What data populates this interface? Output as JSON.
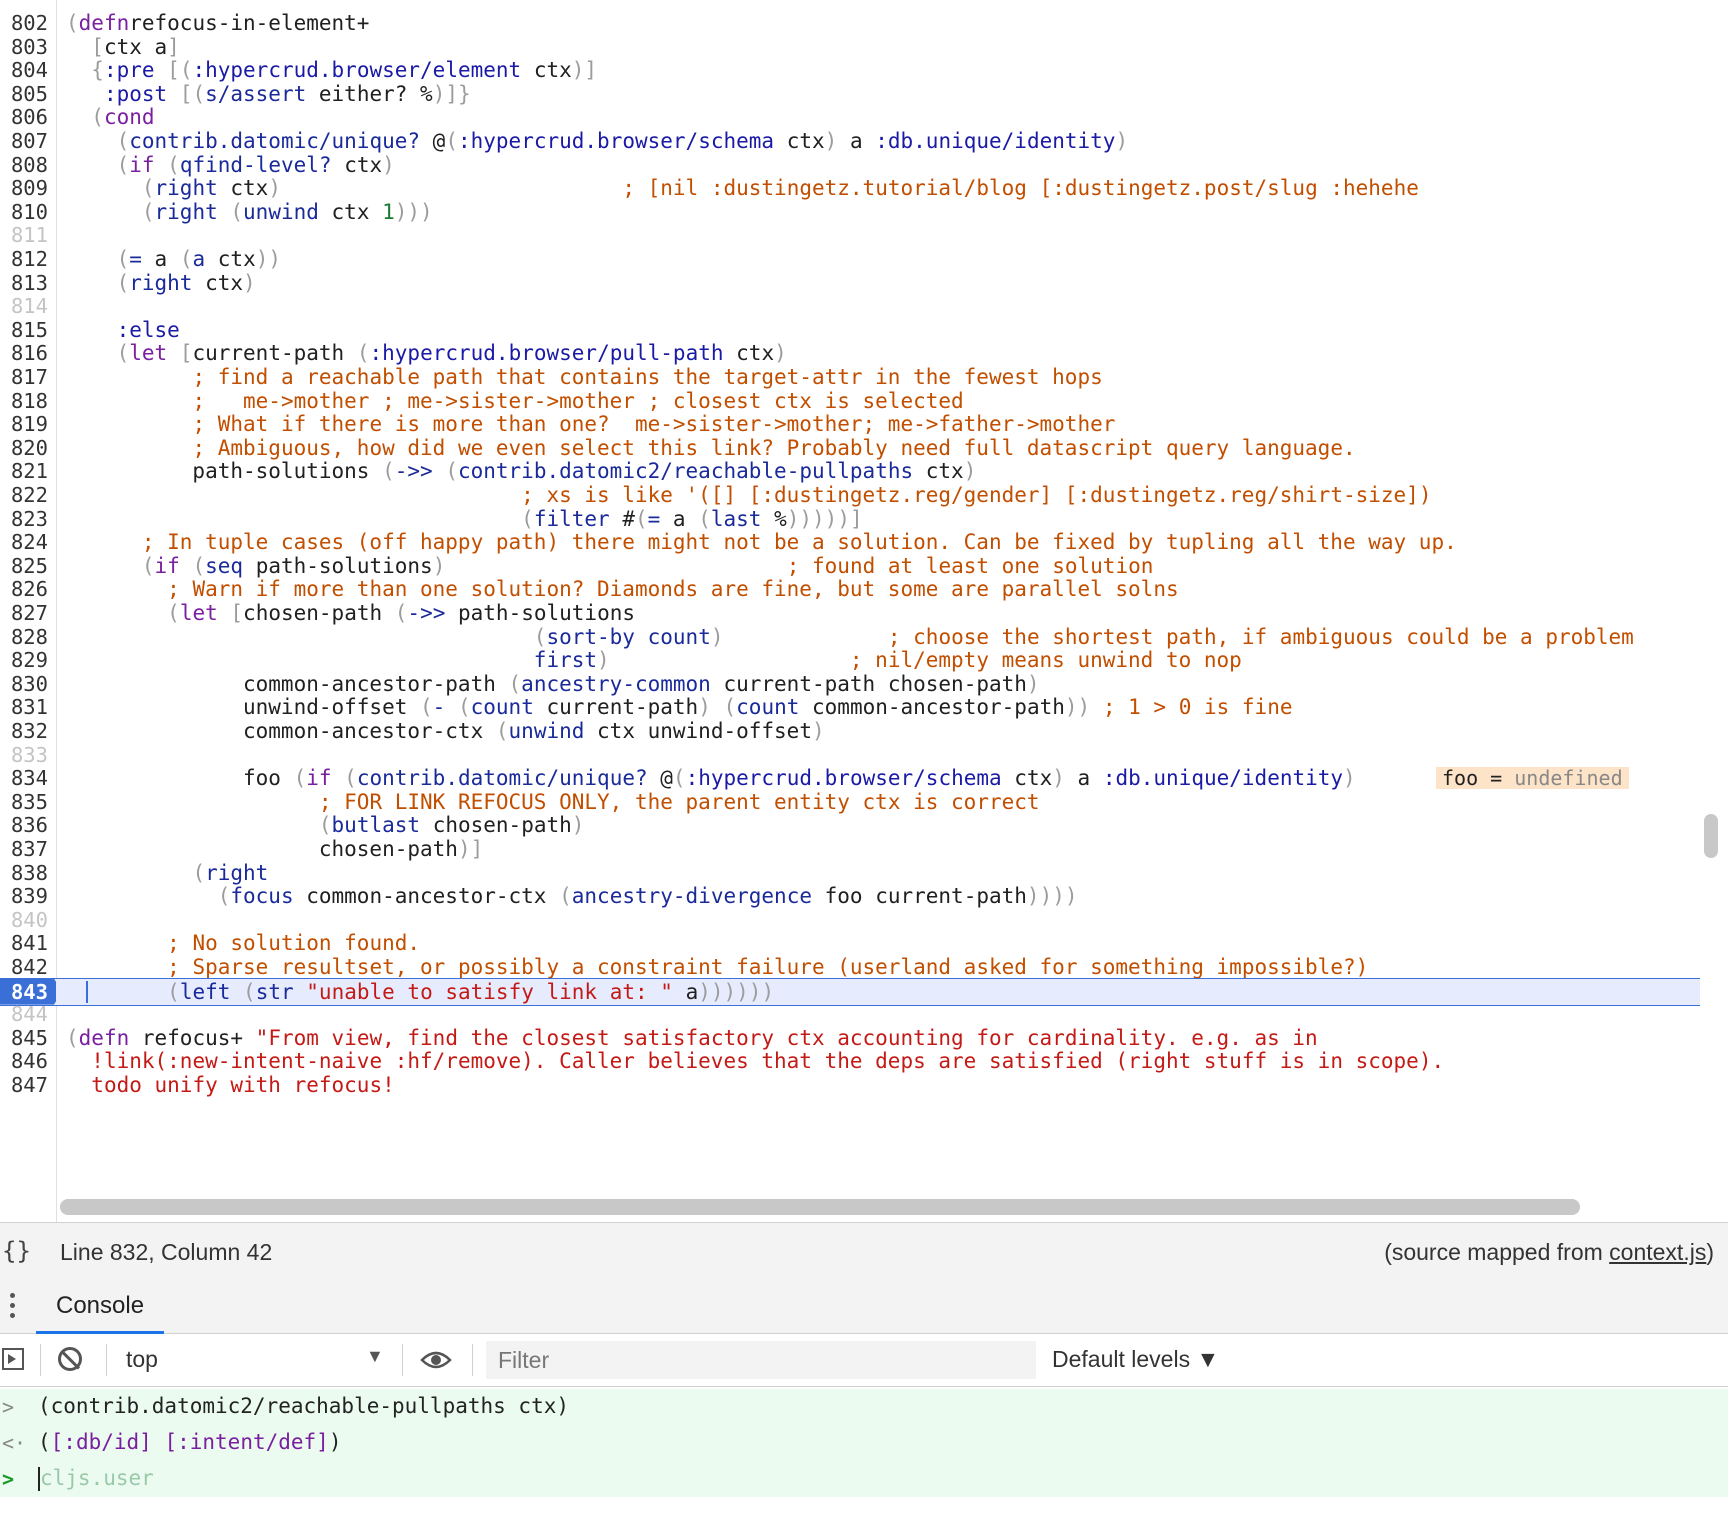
{
  "editor": {
    "lines": [
      {
        "n": "802",
        "segs": [
          [
            "p",
            "("
          ],
          [
            "kw",
            "defn"
          ],
          [
            "",
            "refocus-in-element+"
          ]
        ]
      },
      {
        "n": "803",
        "segs": [
          [
            "",
            "  "
          ],
          [
            "p",
            "["
          ],
          [
            "",
            "ctx a"
          ],
          [
            "p",
            "]"
          ]
        ]
      },
      {
        "n": "804",
        "segs": [
          [
            "",
            "  "
          ],
          [
            "p",
            "{"
          ],
          [
            "kwd",
            ":pre"
          ],
          [
            "p",
            " [("
          ],
          [
            "kwd",
            ":hypercrud.browser/element"
          ],
          [
            "",
            " ctx"
          ],
          [
            "p",
            ")]"
          ]
        ]
      },
      {
        "n": "805",
        "segs": [
          [
            "",
            "   "
          ],
          [
            "kwd",
            ":post"
          ],
          [
            "p",
            " [("
          ],
          [
            "sym",
            "s/assert"
          ],
          [
            "",
            " either? %"
          ],
          [
            "p",
            ")]}"
          ]
        ]
      },
      {
        "n": "806",
        "segs": [
          [
            "",
            "  "
          ],
          [
            "p",
            "("
          ],
          [
            "kw",
            "cond"
          ]
        ]
      },
      {
        "n": "807",
        "segs": [
          [
            "",
            "    "
          ],
          [
            "p",
            "("
          ],
          [
            "sym",
            "contrib.datomic/unique?"
          ],
          [
            "",
            " @"
          ],
          [
            "p",
            "("
          ],
          [
            "kwd",
            ":hypercrud.browser/schema"
          ],
          [
            "",
            " ctx"
          ],
          [
            "p",
            ")"
          ],
          [
            "",
            " a "
          ],
          [
            "kwd",
            ":db.unique/identity"
          ],
          [
            "p",
            ")"
          ]
        ]
      },
      {
        "n": "808",
        "segs": [
          [
            "",
            "    "
          ],
          [
            "p",
            "("
          ],
          [
            "kw",
            "if"
          ],
          [
            "p",
            " ("
          ],
          [
            "sym",
            "qfind-level?"
          ],
          [
            "",
            " ctx"
          ],
          [
            "p",
            ")"
          ]
        ]
      },
      {
        "n": "809",
        "segs": [
          [
            "",
            "      "
          ],
          [
            "p",
            "("
          ],
          [
            "sym",
            "right"
          ],
          [
            "",
            " ctx"
          ],
          [
            "p",
            ")"
          ],
          [
            "",
            "                           "
          ],
          [
            "cm",
            "; [nil :dustingetz.tutorial/blog [:dustingetz.post/slug :hehehe"
          ]
        ]
      },
      {
        "n": "810",
        "segs": [
          [
            "",
            "      "
          ],
          [
            "p",
            "("
          ],
          [
            "sym",
            "right"
          ],
          [
            "p",
            " ("
          ],
          [
            "sym",
            "unwind"
          ],
          [
            "",
            " ctx "
          ],
          [
            "num",
            "1"
          ],
          [
            "p",
            ")))"
          ]
        ]
      },
      {
        "n": "811",
        "segs": []
      },
      {
        "n": "812",
        "segs": [
          [
            "",
            "    "
          ],
          [
            "p",
            "("
          ],
          [
            "sym",
            "="
          ],
          [
            "",
            " a "
          ],
          [
            "p",
            "("
          ],
          [
            "sym",
            "a"
          ],
          [
            "",
            " ctx"
          ],
          [
            "p",
            "))"
          ]
        ]
      },
      {
        "n": "813",
        "segs": [
          [
            "",
            "    "
          ],
          [
            "p",
            "("
          ],
          [
            "sym",
            "right"
          ],
          [
            "",
            " ctx"
          ],
          [
            "p",
            ")"
          ]
        ]
      },
      {
        "n": "814",
        "segs": []
      },
      {
        "n": "815",
        "segs": [
          [
            "",
            "    "
          ],
          [
            "kwd",
            ":else"
          ]
        ]
      },
      {
        "n": "816",
        "segs": [
          [
            "",
            "    "
          ],
          [
            "p",
            "("
          ],
          [
            "kw",
            "let"
          ],
          [
            "p",
            " ["
          ],
          [
            "",
            "current-path "
          ],
          [
            "p",
            "("
          ],
          [
            "kwd",
            ":hypercrud.browser/pull-path"
          ],
          [
            "",
            " ctx"
          ],
          [
            "p",
            ")"
          ]
        ]
      },
      {
        "n": "817",
        "segs": [
          [
            "",
            "          "
          ],
          [
            "cm",
            "; find a reachable path that contains the target-attr in the fewest hops"
          ]
        ]
      },
      {
        "n": "818",
        "segs": [
          [
            "",
            "          "
          ],
          [
            "cm",
            ";   me->mother ; me->sister->mother ; closest ctx is selected"
          ]
        ]
      },
      {
        "n": "819",
        "segs": [
          [
            "",
            "          "
          ],
          [
            "cm",
            "; What if there is more than one?  me->sister->mother; me->father->mother"
          ]
        ]
      },
      {
        "n": "820",
        "segs": [
          [
            "",
            "          "
          ],
          [
            "cm",
            "; Ambiguous, how did we even select this link? Probably need full datascript query language."
          ]
        ]
      },
      {
        "n": "821",
        "segs": [
          [
            "",
            "          path-solutions "
          ],
          [
            "p",
            "("
          ],
          [
            "sym",
            "->>"
          ],
          [
            "p",
            " ("
          ],
          [
            "sym",
            "contrib.datomic2/reachable-pullpaths"
          ],
          [
            "",
            " ctx"
          ],
          [
            "p",
            ")"
          ]
        ]
      },
      {
        "n": "822",
        "segs": [
          [
            "",
            "                                    "
          ],
          [
            "cm",
            "; xs is like '([] [:dustingetz.reg/gender] [:dustingetz.reg/shirt-size])"
          ]
        ]
      },
      {
        "n": "823",
        "segs": [
          [
            "",
            "                                    "
          ],
          [
            "p",
            "("
          ],
          [
            "sym",
            "filter"
          ],
          [
            "",
            " #"
          ],
          [
            "p",
            "("
          ],
          [
            "sym",
            "="
          ],
          [
            "",
            " a "
          ],
          [
            "p",
            "("
          ],
          [
            "sym",
            "last"
          ],
          [
            "",
            " %"
          ],
          [
            "p",
            ")))))]"
          ]
        ]
      },
      {
        "n": "824",
        "segs": [
          [
            "",
            "      "
          ],
          [
            "cm",
            "; In tuple cases (off happy path) there might not be a solution. Can be fixed by tupling all the way up."
          ]
        ]
      },
      {
        "n": "825",
        "segs": [
          [
            "",
            "      "
          ],
          [
            "p",
            "("
          ],
          [
            "kw",
            "if"
          ],
          [
            "p",
            " ("
          ],
          [
            "sym",
            "seq"
          ],
          [
            "",
            " path-solutions"
          ],
          [
            "p",
            ")"
          ],
          [
            "",
            "                           "
          ],
          [
            "cm",
            "; found at least one solution"
          ]
        ]
      },
      {
        "n": "826",
        "segs": [
          [
            "",
            "        "
          ],
          [
            "cm",
            "; Warn if more than one solution? Diamonds are fine, but some are parallel solns"
          ]
        ]
      },
      {
        "n": "827",
        "segs": [
          [
            "",
            "        "
          ],
          [
            "p",
            "("
          ],
          [
            "kw",
            "let"
          ],
          [
            "p",
            " ["
          ],
          [
            "",
            "chosen-path "
          ],
          [
            "p",
            "("
          ],
          [
            "sym",
            "->>"
          ],
          [
            "",
            " path-solutions"
          ]
        ]
      },
      {
        "n": "828",
        "segs": [
          [
            "",
            "                                     "
          ],
          [
            "p",
            "("
          ],
          [
            "sym",
            "sort-by"
          ],
          [
            "",
            " "
          ],
          [
            "sym",
            "count"
          ],
          [
            "p",
            ")"
          ],
          [
            "",
            "             "
          ],
          [
            "cm",
            "; choose the shortest path, if ambiguous could be a problem"
          ]
        ]
      },
      {
        "n": "829",
        "segs": [
          [
            "",
            "                                     "
          ],
          [
            "sym",
            "first"
          ],
          [
            "p",
            ")"
          ],
          [
            "",
            "                   "
          ],
          [
            "cm",
            "; nil/empty means unwind to nop"
          ]
        ]
      },
      {
        "n": "830",
        "segs": [
          [
            "",
            "              common-ancestor-path "
          ],
          [
            "p",
            "("
          ],
          [
            "sym",
            "ancestry-common"
          ],
          [
            "",
            " current-path chosen-path"
          ],
          [
            "p",
            ")"
          ]
        ]
      },
      {
        "n": "831",
        "segs": [
          [
            "",
            "              unwind-offset "
          ],
          [
            "p",
            "("
          ],
          [
            "sym",
            "-"
          ],
          [
            "p",
            " ("
          ],
          [
            "sym",
            "count"
          ],
          [
            "",
            " current-path"
          ],
          [
            "p",
            ") ("
          ],
          [
            "sym",
            "count"
          ],
          [
            "",
            " common-ancestor-path"
          ],
          [
            "p",
            "))"
          ],
          [
            "",
            " "
          ],
          [
            "cm",
            "; 1 > 0 is fine"
          ]
        ]
      },
      {
        "n": "832",
        "segs": [
          [
            "",
            "              common-ancestor-ctx "
          ],
          [
            "p",
            "("
          ],
          [
            "sym",
            "unwind"
          ],
          [
            "",
            " ctx unwind-offset"
          ],
          [
            "p",
            ")"
          ]
        ]
      },
      {
        "n": "833",
        "segs": []
      },
      {
        "n": "834",
        "segs": [
          [
            "",
            "              foo "
          ],
          [
            "p",
            "("
          ],
          [
            "kw",
            "if"
          ],
          [
            "p",
            " ("
          ],
          [
            "sym",
            "contrib.datomic/unique?"
          ],
          [
            "",
            " @"
          ],
          [
            "p",
            "("
          ],
          [
            "kwd",
            ":hypercrud.browser/schema"
          ],
          [
            "",
            " ctx"
          ],
          [
            "p",
            ")"
          ],
          [
            "",
            " a "
          ],
          [
            "kwd",
            ":db.unique/identity"
          ],
          [
            "p",
            ")"
          ]
        ],
        "inline": {
          "name": "foo",
          "eq": "=",
          "value": "undefined"
        }
      },
      {
        "n": "835",
        "segs": [
          [
            "",
            "                    "
          ],
          [
            "cm",
            "; FOR LINK REFOCUS ONLY, the parent entity ctx is correct"
          ]
        ]
      },
      {
        "n": "836",
        "segs": [
          [
            "",
            "                    "
          ],
          [
            "p",
            "("
          ],
          [
            "sym",
            "butlast"
          ],
          [
            "",
            " chosen-path"
          ],
          [
            "p",
            ")"
          ]
        ]
      },
      {
        "n": "837",
        "segs": [
          [
            "",
            "                    chosen-path"
          ],
          [
            "p",
            ")]"
          ]
        ]
      },
      {
        "n": "838",
        "segs": [
          [
            "",
            "          "
          ],
          [
            "p",
            "("
          ],
          [
            "sym",
            "right"
          ]
        ]
      },
      {
        "n": "839",
        "segs": [
          [
            "",
            "            "
          ],
          [
            "p",
            "("
          ],
          [
            "sym",
            "focus"
          ],
          [
            "",
            " common-ancestor-ctx "
          ],
          [
            "p",
            "("
          ],
          [
            "sym",
            "ancestry-divergence"
          ],
          [
            "",
            " foo current-path"
          ],
          [
            "p",
            "))))"
          ]
        ]
      },
      {
        "n": "840",
        "segs": []
      },
      {
        "n": "841",
        "segs": [
          [
            "",
            "        "
          ],
          [
            "cm",
            "; No solution found."
          ]
        ]
      },
      {
        "n": "842",
        "segs": [
          [
            "",
            "        "
          ],
          [
            "cm",
            "; Sparse resultset, or possibly a constraint failure (userland asked for something impossible?)"
          ]
        ]
      },
      {
        "n": "843",
        "segs": [
          [
            "",
            "        "
          ],
          [
            "p",
            "("
          ],
          [
            "sym",
            "left"
          ],
          [
            "p",
            " ("
          ],
          [
            "sym",
            "str"
          ],
          [
            "",
            " "
          ],
          [
            "st",
            "\"unable to satisfy link at: \""
          ],
          [
            "",
            " a"
          ],
          [
            "p",
            "))))))"
          ]
        ],
        "current": true
      },
      {
        "n": "844",
        "segs": []
      },
      {
        "n": "845",
        "segs": [
          [
            "p",
            "("
          ],
          [
            "kw",
            "defn"
          ],
          [
            "",
            " refocus+ "
          ],
          [
            "st",
            "\"From view, find the closest satisfactory ctx accounting for cardinality. e.g. as in"
          ]
        ]
      },
      {
        "n": "846",
        "segs": [
          [
            "",
            "  "
          ],
          [
            "st",
            "!link(:new-intent-naive :hf/remove). Caller believes that the deps are satisfied (right stuff is in scope)."
          ]
        ]
      },
      {
        "n": "847",
        "segs": [
          [
            "",
            "  "
          ],
          [
            "st",
            "todo unify with refocus!"
          ]
        ]
      }
    ]
  },
  "status": {
    "braces": "{}",
    "position": "Line 832, Column 42",
    "source_prefix": "(source mapped from ",
    "source_file": "context.js",
    "source_suffix": ")"
  },
  "drawer": {
    "tab": "Console"
  },
  "console_toolbar": {
    "context": "top",
    "context_arrow": "▼",
    "filter_placeholder": "Filter",
    "levels": "Default levels ▼"
  },
  "console": {
    "input": "(contrib.datomic2/reachable-pullpaths ctx)",
    "result_open": "(",
    "result_k1": "[:db/id]",
    "result_sep": " ",
    "result_k2": "[:intent/def]",
    "result_close": ")",
    "prompt_placeholder": "cljs.user"
  }
}
